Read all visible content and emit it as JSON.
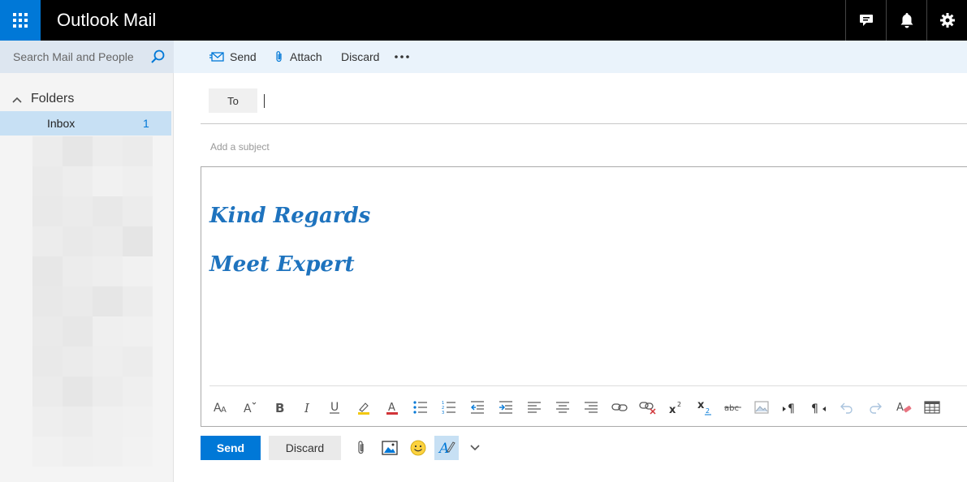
{
  "header": {
    "app_title": "Outlook Mail",
    "brand_color": "#0078d7",
    "icons": [
      "app-launcher-icon",
      "chat-icon",
      "bell-icon",
      "gear-icon"
    ]
  },
  "sidebar": {
    "search_placeholder": "Search Mail and People",
    "folders_label": "Folders",
    "items": [
      {
        "label": "Inbox",
        "count": "1",
        "selected": true
      }
    ]
  },
  "command_bar": {
    "send_label": "Send",
    "attach_label": "Attach",
    "discard_label": "Discard",
    "more_icon": "more-icon"
  },
  "compose": {
    "to_label": "To",
    "to_value": "",
    "subject_placeholder": "Add a subject",
    "body_lines": [
      "Kind Regards",
      "Meet Expert"
    ],
    "signature_color": "#1e73be",
    "formatting_toolbar": [
      "font-icon",
      "font-size-icon",
      "bold-icon",
      "italic-icon",
      "underline-icon",
      "highlight-icon",
      "font-color-icon",
      "bullets-icon",
      "numbering-icon",
      "decrease-indent-icon",
      "increase-indent-icon",
      "align-left-icon",
      "align-center-icon",
      "align-right-icon",
      "insert-link-icon",
      "remove-link-icon",
      "superscript-icon",
      "subscript-icon",
      "strikethrough-icon",
      "insert-picture-icon",
      "ltr-icon",
      "rtl-icon",
      "undo-icon",
      "redo-icon",
      "clear-formatting-icon",
      "insert-table-icon"
    ]
  },
  "actions": {
    "send_label": "Send",
    "discard_label": "Discard",
    "icons": [
      "attach-icon",
      "picture-icon",
      "emoji-icon",
      "format-icon",
      "chevron-down-icon"
    ]
  }
}
